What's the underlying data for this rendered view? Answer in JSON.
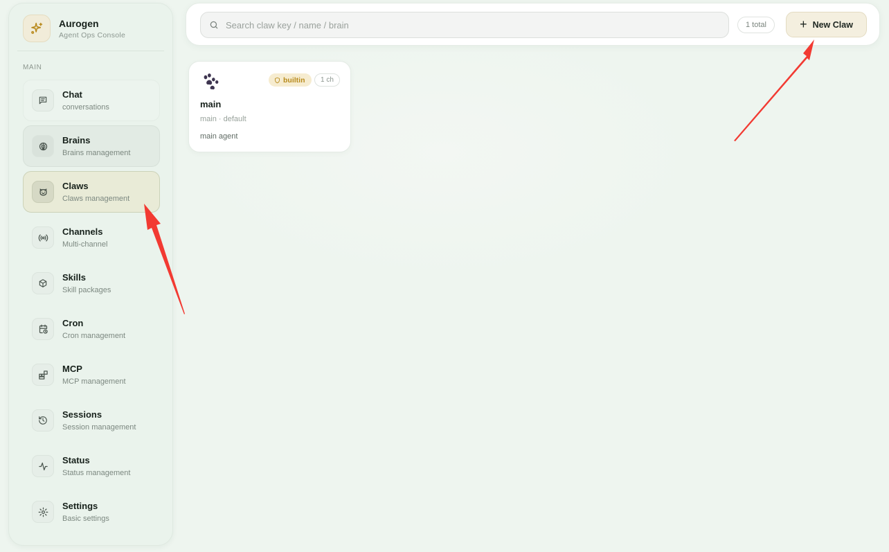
{
  "brand": {
    "name": "Aurogen",
    "subtitle": "Agent Ops Console"
  },
  "sidebar": {
    "section_label": "MAIN",
    "items": [
      {
        "label": "Chat",
        "sub": "conversations",
        "icon": "chat-icon"
      },
      {
        "label": "Brains",
        "sub": "Brains management",
        "icon": "brain-icon"
      },
      {
        "label": "Claws",
        "sub": "Claws management",
        "icon": "claw-icon"
      },
      {
        "label": "Channels",
        "sub": "Multi-channel",
        "icon": "broadcast-icon"
      },
      {
        "label": "Skills",
        "sub": "Skill packages",
        "icon": "package-icon"
      },
      {
        "label": "Cron",
        "sub": "Cron management",
        "icon": "calendar-clock-icon"
      },
      {
        "label": "MCP",
        "sub": "MCP management",
        "icon": "blocks-icon"
      },
      {
        "label": "Sessions",
        "sub": "Session management",
        "icon": "history-icon"
      },
      {
        "label": "Status",
        "sub": "Status management",
        "icon": "activity-icon"
      },
      {
        "label": "Settings",
        "sub": "Basic settings",
        "icon": "gear-icon"
      }
    ],
    "active_index": 2
  },
  "search": {
    "placeholder": "Search claw key / name / brain",
    "value": ""
  },
  "toolbar": {
    "total_label": "1 total",
    "new_label": "New Claw"
  },
  "cards": [
    {
      "icon": "paw-icon",
      "title": "main",
      "meta": "main · default",
      "description": "main agent",
      "badge_builtin": "builtin",
      "badge_channels": "1 ch"
    }
  ],
  "colors": {
    "accent_gold": "#b88a1c",
    "annotation_red": "#f23a32",
    "active_bg": "#e9ebd7"
  }
}
